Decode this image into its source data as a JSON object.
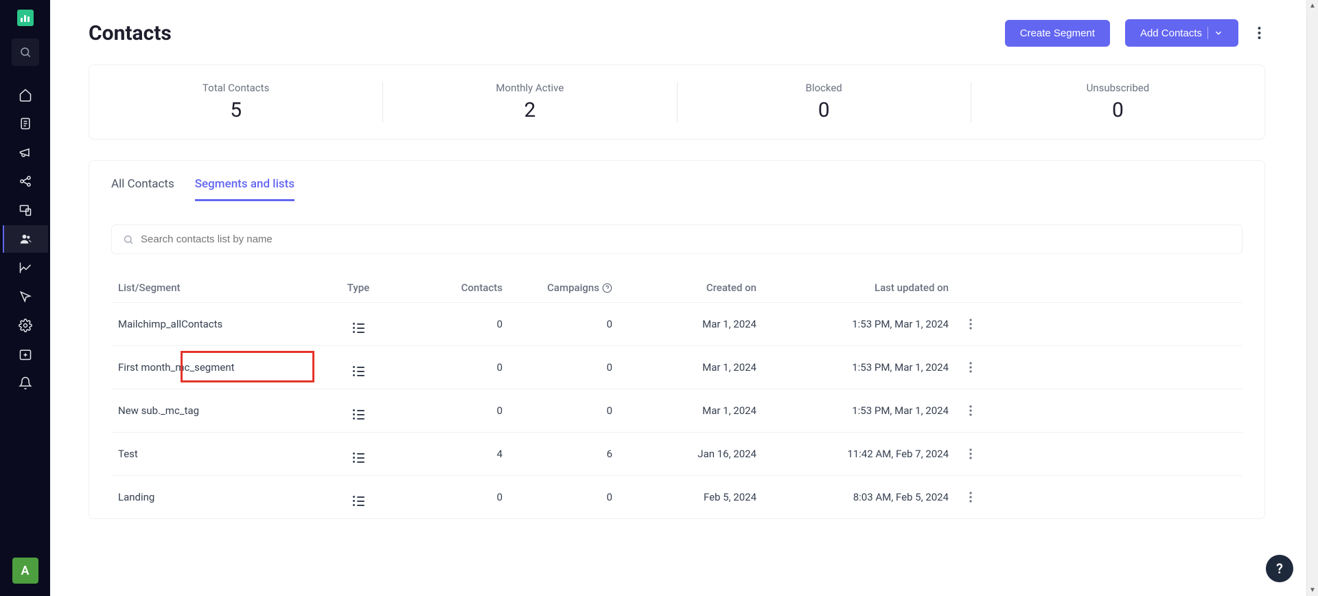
{
  "page": {
    "title": "Contacts"
  },
  "header": {
    "create_segment_label": "Create Segment",
    "add_contacts_label": "Add Contacts"
  },
  "stats": [
    {
      "label": "Total Contacts",
      "value": "5"
    },
    {
      "label": "Monthly Active",
      "value": "2"
    },
    {
      "label": "Blocked",
      "value": "0"
    },
    {
      "label": "Unsubscribed",
      "value": "0"
    }
  ],
  "tabs": {
    "all_contacts": "All Contacts",
    "segments_lists": "Segments and lists"
  },
  "search": {
    "placeholder": "Search contacts list by name"
  },
  "table": {
    "headers": {
      "list_segment": "List/Segment",
      "type": "Type",
      "contacts": "Contacts",
      "campaigns": "Campaigns",
      "created_on": "Created on",
      "last_updated_on": "Last updated on"
    },
    "rows": [
      {
        "name": "Mailchimp_allContacts",
        "contacts": "0",
        "campaigns": "0",
        "created": "Mar 1, 2024",
        "updated": "1:53 PM, Mar 1, 2024"
      },
      {
        "name": "First month_mc_segment",
        "contacts": "0",
        "campaigns": "0",
        "created": "Mar 1, 2024",
        "updated": "1:53 PM, Mar 1, 2024"
      },
      {
        "name": "New sub._mc_tag",
        "contacts": "0",
        "campaigns": "0",
        "created": "Mar 1, 2024",
        "updated": "1:53 PM, Mar 1, 2024"
      },
      {
        "name": "Test",
        "contacts": "4",
        "campaigns": "6",
        "created": "Jan 16, 2024",
        "updated": "11:42 AM, Feb 7, 2024"
      },
      {
        "name": "Landing",
        "contacts": "0",
        "campaigns": "0",
        "created": "Feb 5, 2024",
        "updated": "8:03 AM, Feb 5, 2024"
      }
    ]
  },
  "avatar": {
    "initial": "A"
  },
  "help": {
    "label": "?"
  }
}
